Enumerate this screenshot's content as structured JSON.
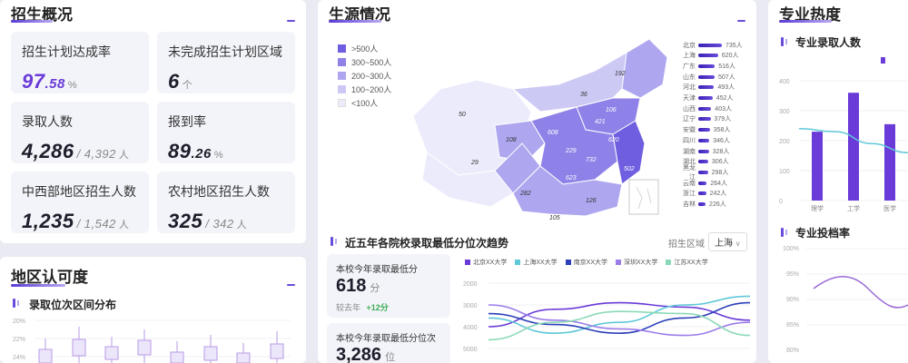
{
  "left": {
    "title": "招生概况",
    "cards": [
      {
        "label": "招生计划达成率",
        "value": "97",
        "decimal": ".58",
        "unit": "%"
      },
      {
        "label": "未完成招生计划区域",
        "value": "6",
        "unit": "个"
      },
      {
        "label": "录取人数",
        "value": "4,286",
        "total": "/ 4,392",
        "unit": "人"
      },
      {
        "label": "报到率",
        "value": "89",
        "decimal": ".26",
        "unit": "%"
      },
      {
        "label": "中西部地区招生人数",
        "value": "1,235",
        "total": "/ 1,542",
        "unit": "人"
      },
      {
        "label": "农村地区招生人数",
        "value": "325",
        "total": "/ 342",
        "unit": "人"
      }
    ],
    "region": {
      "title": "地区认可度",
      "subtitle": "录取位次区间分布",
      "yticks": [
        "20%",
        "22%",
        "24%"
      ]
    }
  },
  "middle": {
    "title": "生源情况",
    "legend": [
      {
        "label": ">500人",
        "color": "#6f5fe0"
      },
      {
        "label": "300~500人",
        "color": "#8e82e8"
      },
      {
        "label": "200~300人",
        "color": "#aea7ef"
      },
      {
        "label": "100~200人",
        "color": "#cdc9f5"
      },
      {
        "label": "<100人",
        "color": "#ecebfb"
      }
    ],
    "map_labels": [
      "192",
      "50",
      "36",
      "108",
      "29",
      "106",
      "608",
      "229",
      "421",
      "620",
      "732",
      "502",
      "623",
      "282",
      "126",
      "105"
    ],
    "ranking": [
      {
        "name": "北京",
        "value": "735人",
        "frac": 1.0
      },
      {
        "name": "上海",
        "value": "620人",
        "frac": 0.84
      },
      {
        "name": "广东",
        "value": "516人",
        "frac": 0.7
      },
      {
        "name": "山东",
        "value": "507人",
        "frac": 0.69
      },
      {
        "name": "河北",
        "value": "493人",
        "frac": 0.67
      },
      {
        "name": "天津",
        "value": "452人",
        "frac": 0.61
      },
      {
        "name": "山西",
        "value": "403人",
        "frac": 0.55
      },
      {
        "name": "辽宁",
        "value": "379人",
        "frac": 0.52
      },
      {
        "name": "安徽",
        "value": "358人",
        "frac": 0.49
      },
      {
        "name": "四川",
        "value": "346人",
        "frac": 0.47
      },
      {
        "name": "湖南",
        "value": "328人",
        "frac": 0.45
      },
      {
        "name": "湖北",
        "value": "306人",
        "frac": 0.42
      },
      {
        "name": "黑龙江",
        "value": "298人",
        "frac": 0.41
      },
      {
        "name": "云南",
        "value": "264人",
        "frac": 0.36
      },
      {
        "name": "浙江",
        "value": "242人",
        "frac": 0.33
      },
      {
        "name": "吉林",
        "value": "226人",
        "frac": 0.31
      }
    ],
    "trend": {
      "title": "近五年各院校录取最低分位次趋势",
      "region_label": "招生区域",
      "region_value": "上海",
      "card1": {
        "label": "本校今年录取最低分",
        "value": "618",
        "unit": "分",
        "compare_label": "较去年",
        "compare_value": "+12分"
      },
      "card2": {
        "label": "本校今年录取最低分位次",
        "value": "3,286",
        "unit": "位"
      },
      "legend": [
        {
          "label": "北京XX大学",
          "color": "#6a3bd8"
        },
        {
          "label": "上海XX大学",
          "color": "#5fc8d8"
        },
        {
          "label": "南京XX大学",
          "color": "#2b3fb8"
        },
        {
          "label": "深圳XX大学",
          "color": "#9b7de8"
        },
        {
          "label": "江苏XX大学",
          "color": "#8bd9b8"
        }
      ],
      "yticks": [
        "2000",
        "3000",
        "4000",
        "5000"
      ]
    }
  },
  "right": {
    "title": "专业热度",
    "admit": {
      "title": "专业录取人数",
      "yticks": [
        "400",
        "300",
        "200",
        "100",
        "0"
      ],
      "categories": [
        "理学",
        "工学",
        "医学"
      ],
      "values": [
        230,
        360,
        255
      ],
      "line": [
        240,
        230,
        190,
        160
      ]
    },
    "rate": {
      "title": "专业投档率",
      "yticks": [
        "100%",
        "95%",
        "90%",
        "85%",
        "80%"
      ]
    }
  },
  "chart_data": [
    {
      "type": "bar",
      "title": "专业录取人数",
      "categories": [
        "理学",
        "工学",
        "医学"
      ],
      "values": [
        230,
        360,
        255
      ],
      "ylim": [
        0,
        400
      ]
    },
    {
      "type": "line",
      "title": "近五年各院校录取最低分位次趋势",
      "series": [
        {
          "name": "北京XX大学",
          "values": [
            4000,
            3200,
            2900,
            3100,
            3700
          ]
        },
        {
          "name": "上海XX大学",
          "values": [
            3600,
            4300,
            3800,
            3000,
            2600
          ]
        },
        {
          "name": "南京XX大学",
          "values": [
            3400,
            3900,
            4300,
            3600,
            2900
          ]
        },
        {
          "name": "深圳XX大学",
          "values": [
            3000,
            3700,
            4100,
            4400,
            3800
          ]
        },
        {
          "name": "江苏XX大学",
          "values": [
            4600,
            3800,
            3300,
            3400,
            4400
          ]
        }
      ],
      "ylim": [
        2000,
        5000
      ]
    }
  ]
}
